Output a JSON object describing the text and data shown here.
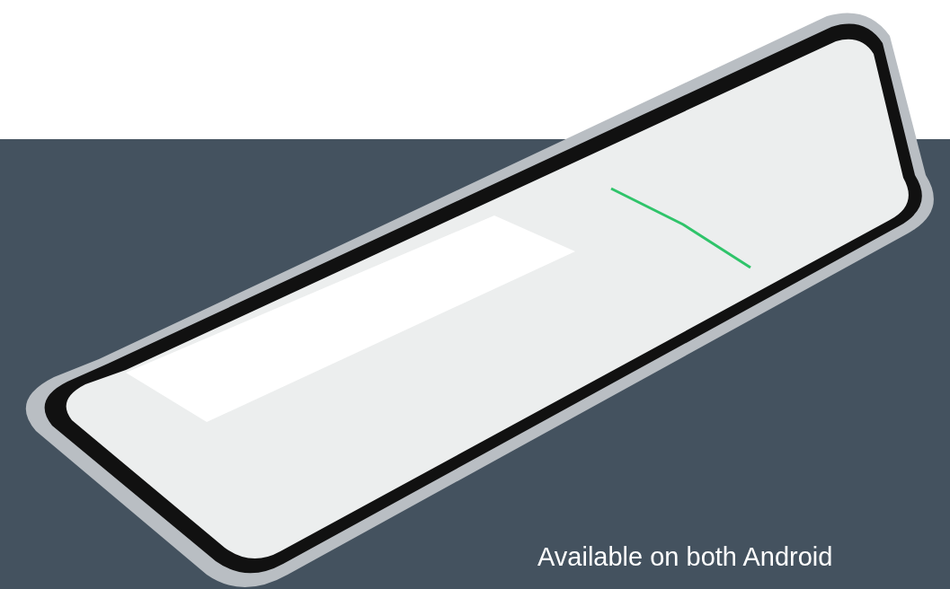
{
  "hero": {
    "caption": "Available on both Android"
  }
}
